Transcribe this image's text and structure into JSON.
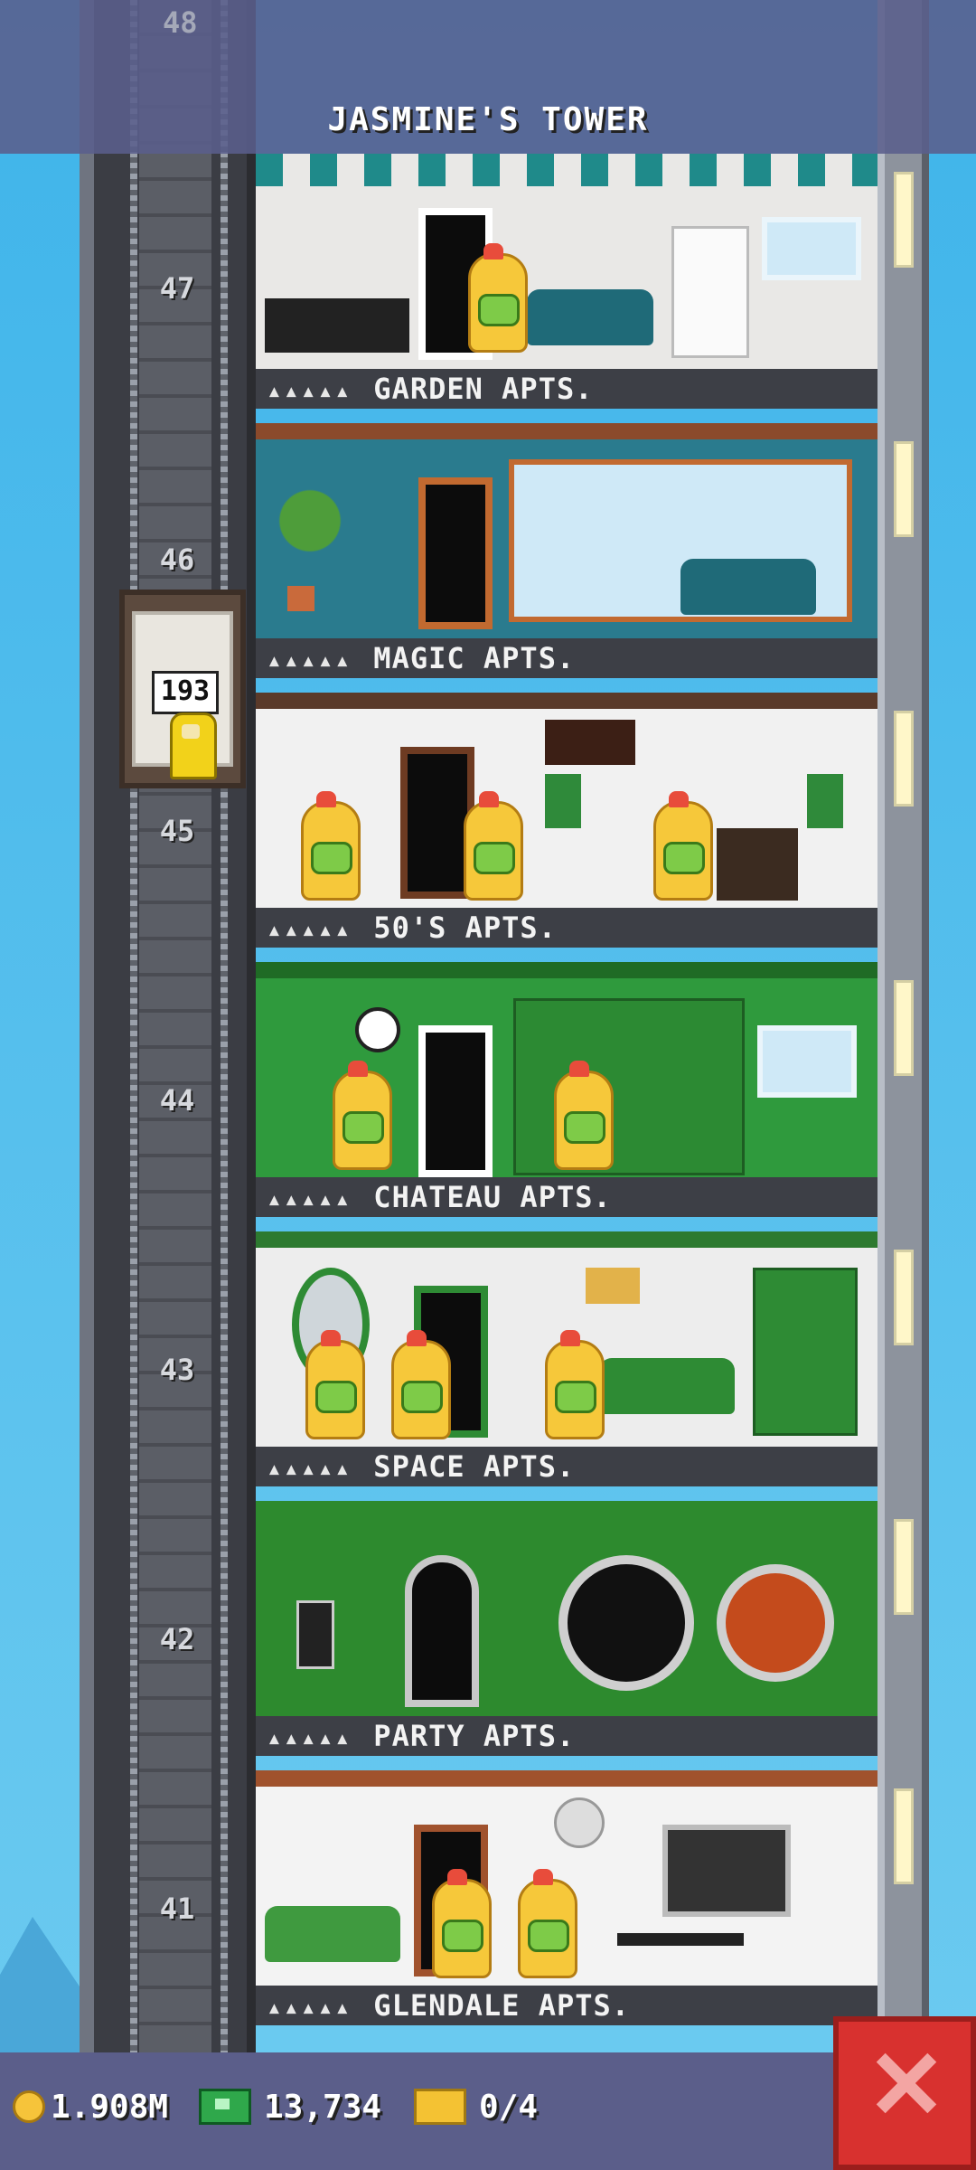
{
  "header": {
    "title": "JASMINE'S TOWER",
    "top_floor_number": "48"
  },
  "elevator": {
    "passenger_count": "193"
  },
  "floors": [
    {
      "number": "47",
      "name": "GARDEN APTS.",
      "stars": "▴▴▴▴▴",
      "color": "#e9e8e6"
    },
    {
      "number": "46",
      "name": "MAGIC APTS.",
      "stars": "▴▴▴▴▴",
      "color": "#2a7b8e"
    },
    {
      "number": "45",
      "name": "50'S APTS.",
      "stars": "▴▴▴▴▴",
      "color": "#f1f1f1"
    },
    {
      "number": "44",
      "name": "CHATEAU APTS.",
      "stars": "▴▴▴▴▴",
      "color": "#2f9a3d"
    },
    {
      "number": "43",
      "name": "SPACE APTS.",
      "stars": "▴▴▴▴▴",
      "color": "#ededed"
    },
    {
      "number": "42",
      "name": "PARTY APTS.",
      "stars": "▴▴▴▴▴",
      "color": "#2d8a2e"
    },
    {
      "number": "41",
      "name": "GLENDALE APTS.",
      "stars": "▴▴▴▴▴",
      "color": "#f3f3f3"
    }
  ],
  "status": {
    "coins": "1.908M",
    "bux": "13,734",
    "tickets": "0/4"
  },
  "icons": {
    "coin": "coin-icon",
    "bux": "cash-icon",
    "ticket": "ticket-icon",
    "close": "close-icon"
  },
  "colors": {
    "close_button": "#d8312f",
    "header_bar": "#5a5e8c",
    "bottom_bar": "#5b5e8a"
  }
}
